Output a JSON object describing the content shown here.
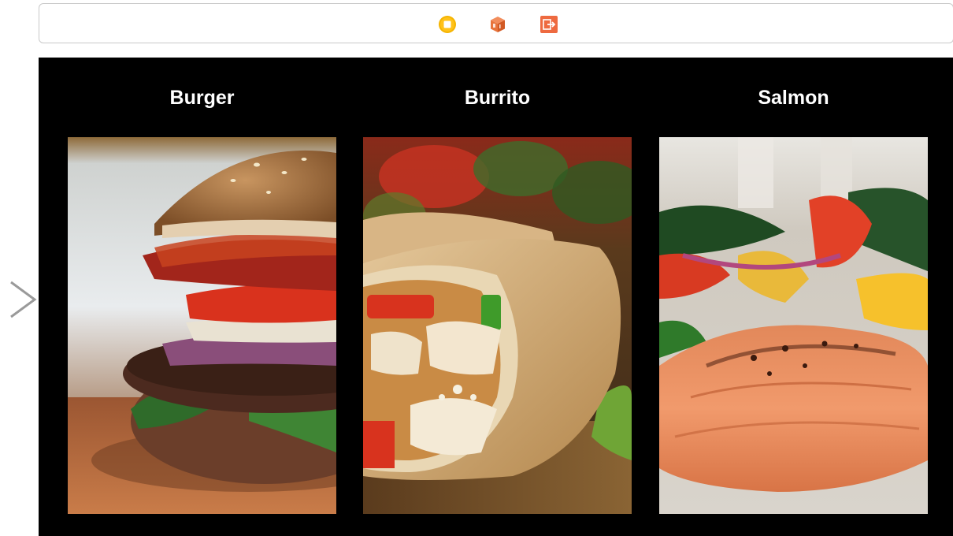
{
  "toolbar": {
    "icons": [
      "stop-icon",
      "cube-icon",
      "exit-icon"
    ],
    "colors": {
      "stop": "#F5B400",
      "cube": "#E8743B",
      "exit": "#EE6A40"
    }
  },
  "entry_arrow": {
    "icon": "chevron-right-icon",
    "color": "#9a9a9a"
  },
  "canvas": {
    "background": "#000000"
  },
  "items": [
    {
      "title": "Burger"
    },
    {
      "title": "Burrito"
    },
    {
      "title": "Salmon"
    }
  ]
}
